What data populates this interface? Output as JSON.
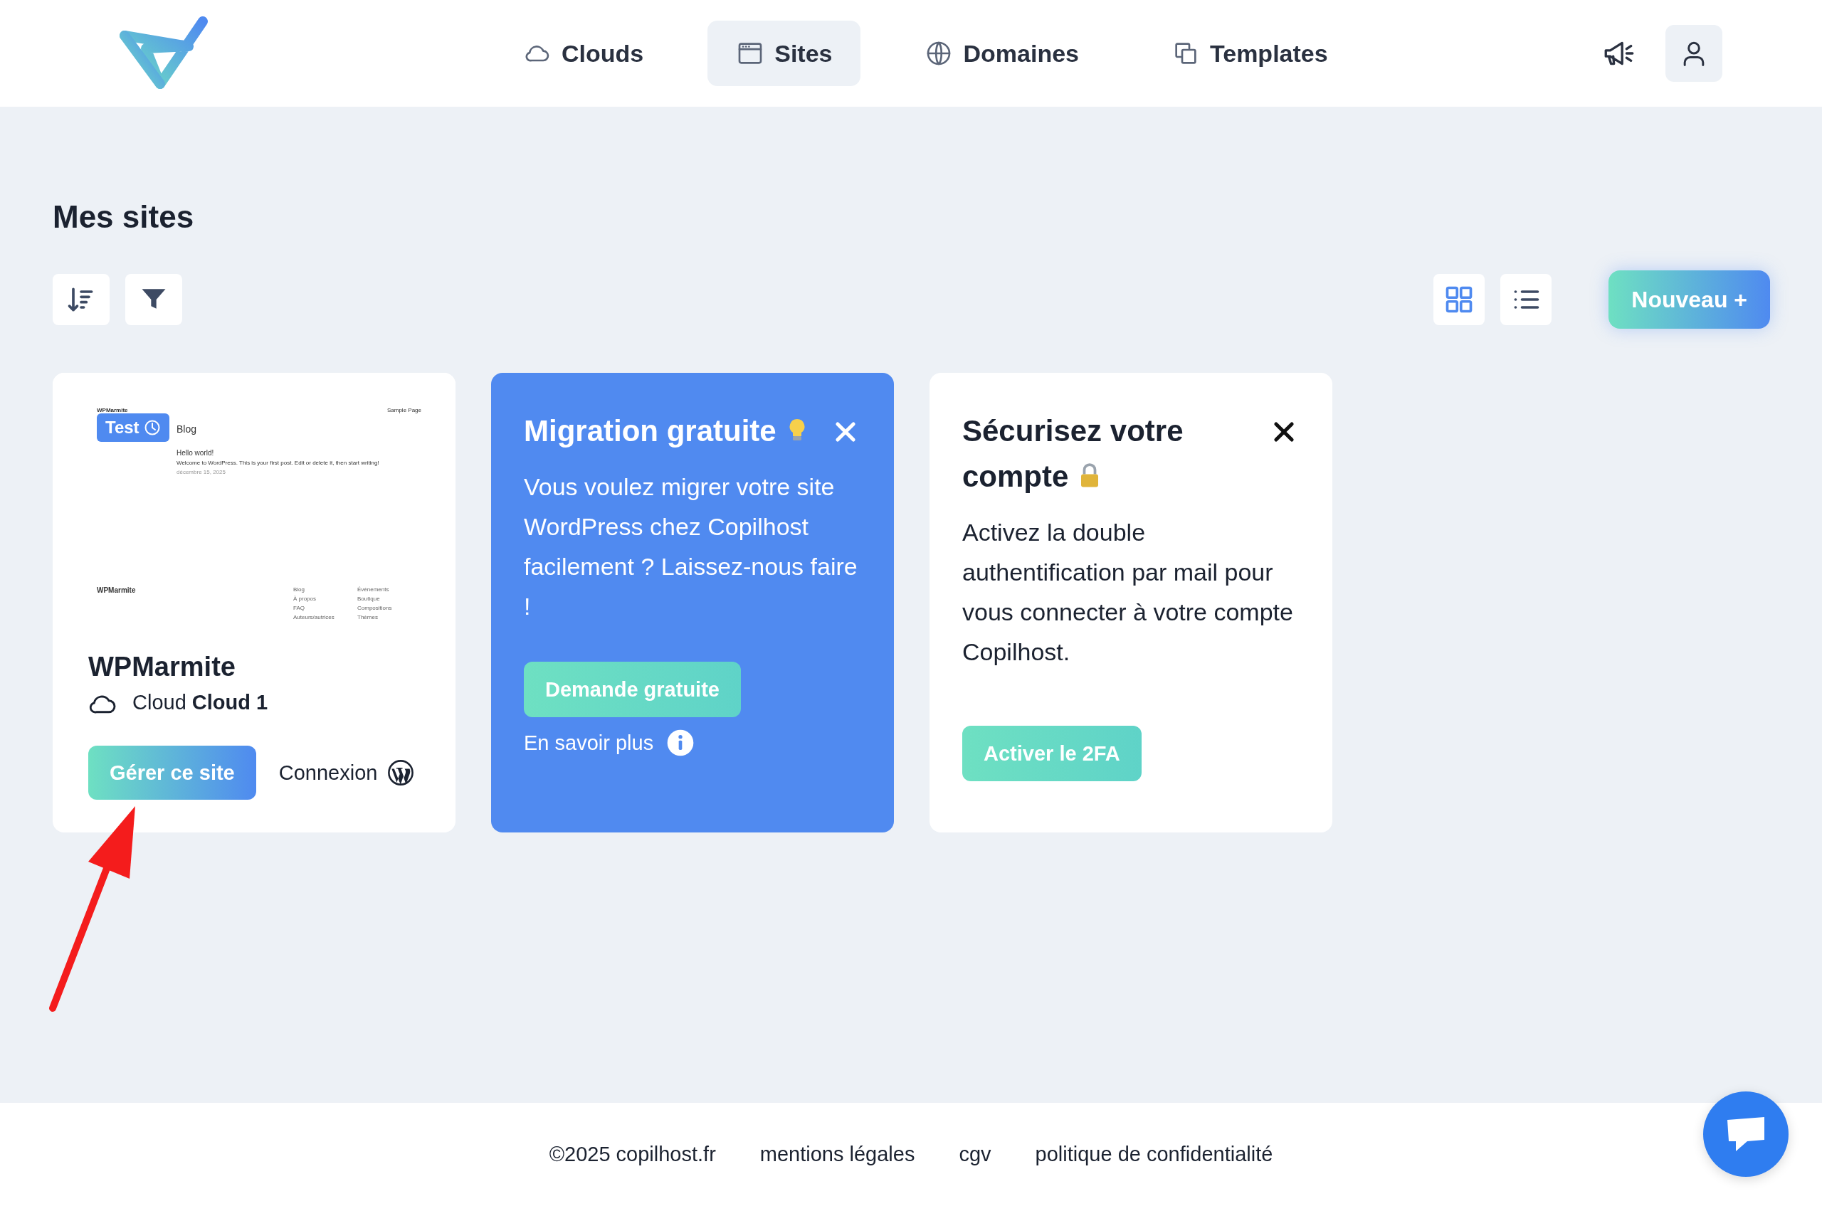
{
  "header": {
    "nav": [
      {
        "label": "Clouds",
        "selected": false
      },
      {
        "label": "Sites",
        "selected": true
      },
      {
        "label": "Domaines",
        "selected": false
      },
      {
        "label": "Templates",
        "selected": false
      }
    ]
  },
  "page_title": "Mes sites",
  "toolbar": {
    "views": [
      {
        "kind": "grid",
        "selected": true
      },
      {
        "kind": "list",
        "selected": false
      }
    ],
    "new_button": "Nouveau +"
  },
  "cards": [
    {
      "kind": "site",
      "badge": "Test",
      "preview": {
        "site_title": "WPMarmite",
        "menu": "Sample Page",
        "heading": "Blog",
        "post_title": "Hello world!",
        "excerpt": "Welcome to WordPress. This is your first post. Edit or delete it, then start writing!",
        "date": "décembre 15, 2025",
        "footer_title": "WPMarmite",
        "footer_links": [
          [
            "Blog",
            "À propos",
            "FAQ",
            "Auteurs/autrices"
          ],
          [
            "Événements",
            "Boutique",
            "Compositions",
            "Thèmes"
          ]
        ]
      },
      "name": "WPMarmite",
      "cloud": "Cloud **Cloud 1**",
      "button": "Gérer ce site",
      "login": "Connexion"
    },
    {
      "kind": "promo",
      "title": "Migration gratuite",
      "text": "Vous voulez migrer votre site WordPress chez Copilhost facilement ? Laissez-nous faire !",
      "button": "Demande gratuite",
      "link": "En savoir plus"
    },
    {
      "kind": "notice",
      "title": "Sécurisez votre compte",
      "text": "Activez la double authentification par mail pour vous connecter à votre compte Copilhost.",
      "button": "Activer le 2FA"
    }
  ],
  "footer": {
    "links": [
      "©2025 copilhost.fr",
      "mentions légales",
      "cgv",
      "politique de confidentialité"
    ]
  },
  "annotations": [
    {
      "kind": "arrow"
    }
  ]
}
